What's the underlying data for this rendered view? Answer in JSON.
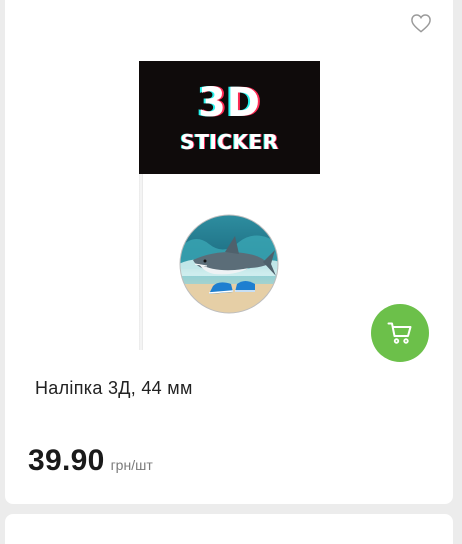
{
  "product": {
    "title": "Наліпка 3Д, 44 мм",
    "price": "39.90",
    "unit": "грн/шт",
    "image": {
      "flag_line1": "3D",
      "flag_line2": "STICKER"
    }
  },
  "actions": {
    "favorite_icon": "heart-outline-icon",
    "cart_icon": "cart-icon"
  },
  "colors": {
    "cart_button": "#6cc04a",
    "flag_background": "#0f0b0b",
    "page_background": "#ececec"
  }
}
